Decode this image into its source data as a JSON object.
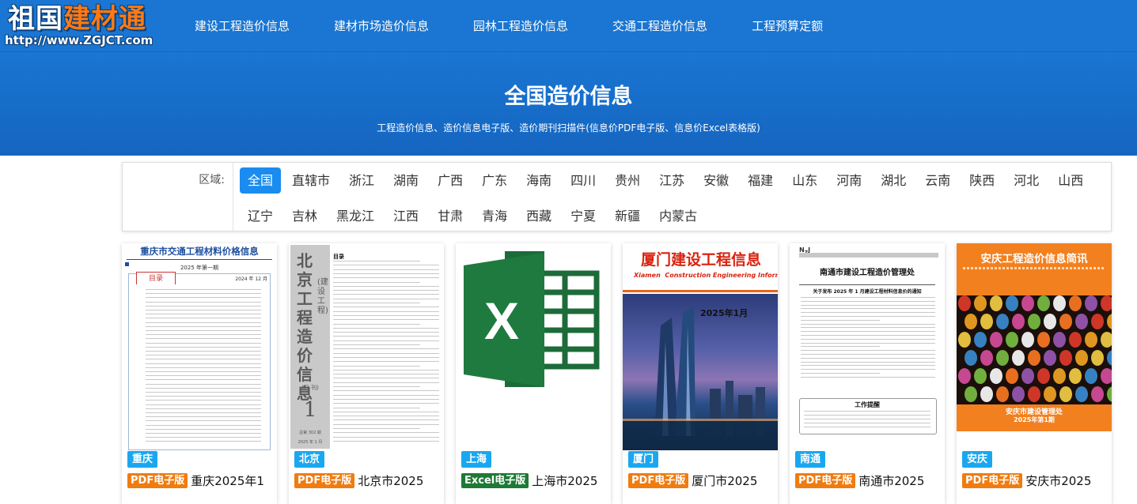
{
  "logo": {
    "main_a": "祖国",
    "main_b": "建材通",
    "url": "http://www.ZGJCT.com"
  },
  "nav": [
    {
      "label": "建设工程造价信息"
    },
    {
      "label": "建材市场造价信息"
    },
    {
      "label": "园林工程造价信息"
    },
    {
      "label": "交通工程造价信息"
    },
    {
      "label": "工程预算定额"
    }
  ],
  "hero": {
    "title": "全国造价信息",
    "subtitle": "工程造价信息、造价信息电子版、造价期刊扫描件(信息价PDF电子版、信息价Excel表格版)"
  },
  "filter": {
    "label": "区域:",
    "active": "全国",
    "regions": [
      "全国",
      "直辖市",
      "浙江",
      "湖南",
      "广西",
      "广东",
      "海南",
      "四川",
      "贵州",
      "江苏",
      "安徽",
      "福建",
      "山东",
      "河南",
      "湖北",
      "云南",
      "陕西",
      "河北",
      "山西",
      "辽宁",
      "吉林",
      "黑龙江",
      "江西",
      "甘肃",
      "青海",
      "西藏",
      "宁夏",
      "新疆",
      "内蒙古"
    ]
  },
  "cards": [
    {
      "city": "重庆",
      "type": "PDF电子版",
      "title": "重庆2025年1",
      "cover": {
        "heading": "重庆市交通工程材料价格信息",
        "issue": "2025 年第一期",
        "toc": "目录",
        "date": "2024 年 12 月"
      }
    },
    {
      "city": "北京",
      "type": "PDF电子版",
      "title": "北京市2025",
      "cover": {
        "spine": "北京工程造价信息",
        "sub": "(建设工程)",
        "period": "(月 刊)",
        "num": "1",
        "total": "总第 302 期",
        "date": "2025 年 1 月",
        "toc": "目录"
      }
    },
    {
      "city": "上海",
      "type": "Excel电子版",
      "title": "上海市2025",
      "cover": {
        "letter": "X"
      }
    },
    {
      "city": "厦门",
      "type": "PDF电子版",
      "title": "厦门市2025",
      "cover": {
        "heading": "厦门建设工程信息",
        "en_a": "Xiamen",
        "en_b": "Construction Engineering Information",
        "issue": "2025年1月"
      }
    },
    {
      "city": "南通",
      "type": "PDF电子版",
      "title": "南通市2025",
      "cover": {
        "heading": "南通市建设工程造价管理处",
        "notice": "关于发布 2025 年 1 月建设工程材料信息价的通知",
        "box_title": "工作提醒"
      }
    },
    {
      "city": "安庆",
      "type": "PDF电子版",
      "title": "安庆市2025",
      "cover": {
        "heading": "安庆工程造价信息简讯",
        "org": "安庆市建设管理处",
        "issue": "2025年第1期"
      }
    }
  ]
}
